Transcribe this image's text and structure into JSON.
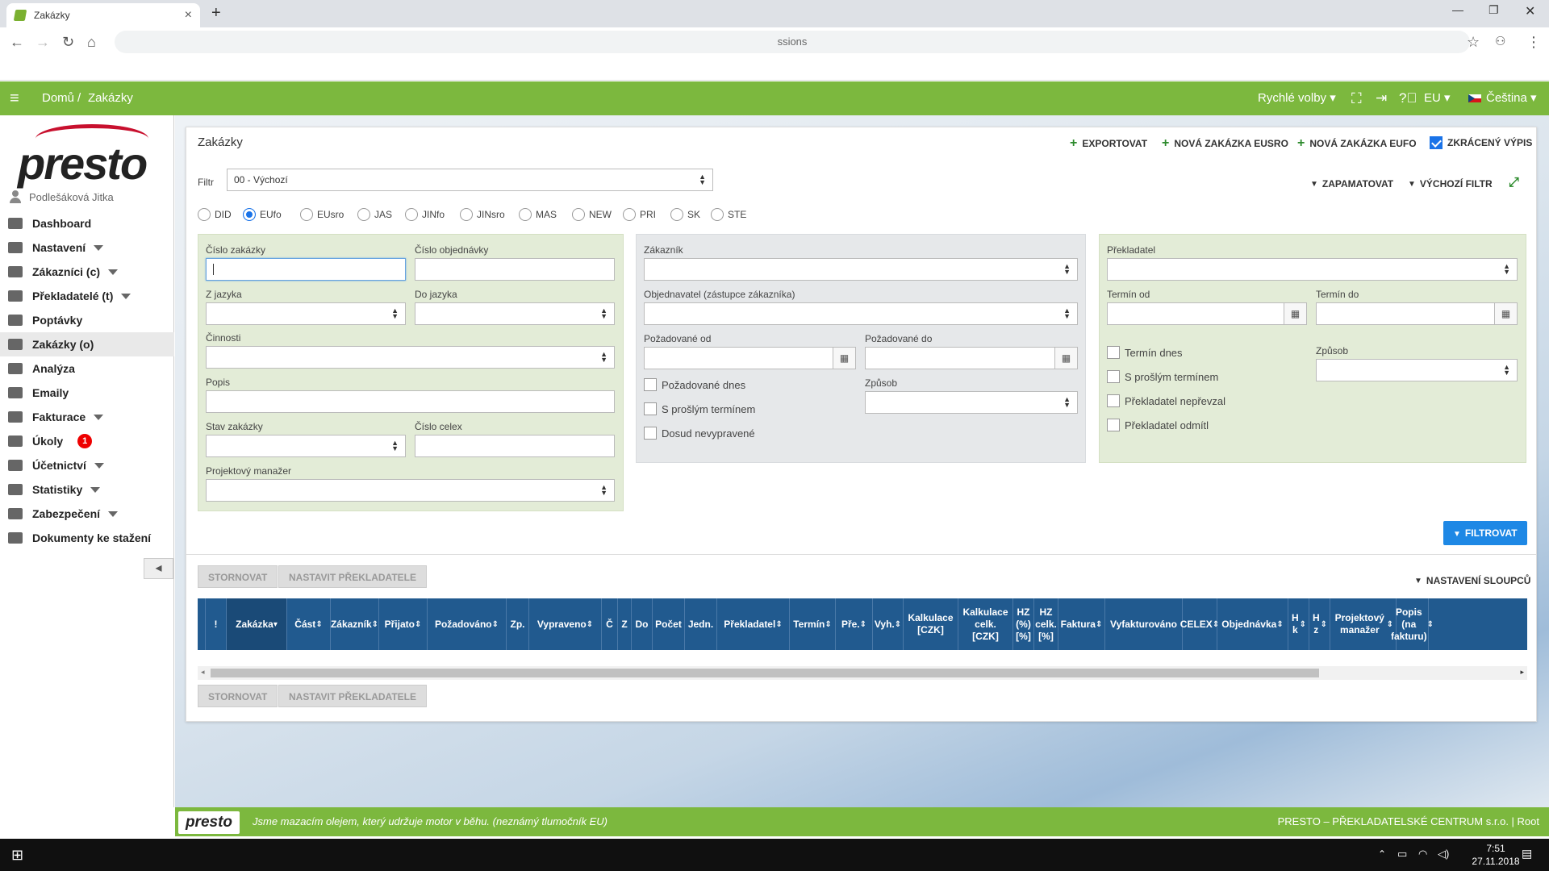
{
  "browser": {
    "tab_title": "Zakázky",
    "address": "ssions"
  },
  "topbar": {
    "home": "Domů",
    "sep": "/",
    "current": "Zakázky",
    "quick": "Rychlé volby",
    "lang_code": "EU",
    "language": "Čeština"
  },
  "user": {
    "name": "Podlešáková Jitka"
  },
  "logo": "presto",
  "menu": [
    {
      "label": "Dashboard",
      "icon": "dashboard-icon",
      "caret": false
    },
    {
      "label": "Nastavení",
      "icon": "cogs-icon",
      "caret": true
    },
    {
      "label": "Zákazníci (c)",
      "icon": "users-icon",
      "caret": true
    },
    {
      "label": "Překladatelé (t)",
      "icon": "globe-icon",
      "caret": true
    },
    {
      "label": "Poptávky",
      "icon": "copy-icon",
      "caret": false
    },
    {
      "label": "Zakázky (o)",
      "icon": "book-icon",
      "caret": false,
      "active": true
    },
    {
      "label": "Analýza",
      "icon": "book-icon",
      "caret": false
    },
    {
      "label": "Emaily",
      "icon": "envelope-icon",
      "caret": false
    },
    {
      "label": "Fakturace",
      "icon": "book-icon",
      "caret": true
    },
    {
      "label": "Úkoly",
      "icon": "tasks-icon",
      "caret": false,
      "badge": "1"
    },
    {
      "label": "Účetnictví",
      "icon": "money-icon",
      "caret": true
    },
    {
      "label": "Statistiky",
      "icon": "chart-icon",
      "caret": true
    },
    {
      "label": "Zabezpečení",
      "icon": "shield-icon",
      "caret": true
    },
    {
      "label": "Dokumenty ke stažení",
      "icon": "cloud-download-icon",
      "caret": false
    }
  ],
  "panel": {
    "title": "Zakázky",
    "export": "EXPORTOVAT",
    "new_eusro": "NOVÁ ZAKÁZKA EUSRO",
    "new_eufo": "NOVÁ ZAKÁZKA EUFO",
    "short": "ZKRÁCENÝ VÝPIS"
  },
  "filter": {
    "label": "Filtr",
    "value": "00 - Výchozí",
    "remember": "ZAPAMATOVAT",
    "default": "VÝCHOZÍ FILTR"
  },
  "radios": [
    "DID",
    "EUfo",
    "EUsro",
    "JAS",
    "JINfo",
    "JINsro",
    "MAS",
    "NEW",
    "PRI",
    "SK",
    "STE"
  ],
  "radio_selected": "EUfo",
  "box1": {
    "cislo_zakazky": "Číslo zakázky",
    "cislo_objednavky": "Číslo objednávky",
    "z_jazyka": "Z jazyka",
    "do_jazyka": "Do jazyka",
    "cinnosti": "Činnosti",
    "popis": "Popis",
    "stav": "Stav zakázky",
    "celex": "Číslo celex",
    "pm": "Projektový manažer"
  },
  "box2": {
    "zakaznik": "Zákazník",
    "objednavatel": "Objednavatel (zástupce zákazníka)",
    "pozad_od": "Požadované od",
    "pozad_do": "Požadované do",
    "dnes": "Požadované dnes",
    "proslym": "S prošlým termínem",
    "nevypravene": "Dosud nevypravené",
    "zpusob": "Způsob"
  },
  "box3": {
    "prekladatel": "Překladatel",
    "termin_od": "Termín od",
    "termin_do": "Termín do",
    "termin_dnes": "Termín dnes",
    "proslym": "S prošlým termínem",
    "nepr": "Překladatel nepřevzal",
    "odm": "Překladatel odmítl",
    "zpusob": "Způsob"
  },
  "buttons": {
    "filter": "FILTROVAT",
    "cancel": "STORNOVAT",
    "set_translator": "NASTAVIT PŘEKLADATELE",
    "columns": "NASTAVENÍ SLOUPCŮ"
  },
  "table_headers": [
    "",
    "!",
    "Zakázka",
    "Část",
    "Zákazník",
    "Přijato",
    "Požadováno",
    "Zp.",
    "Vypraveno",
    "Č",
    "Z",
    "Do",
    "Počet",
    "Jedn.",
    "Překladatel",
    "Termín",
    "Pře.",
    "Vyh.",
    "Kalkulace [CZK]",
    "Kalkulace celk. [CZK]",
    "HZ (%) [%]",
    "HZ celk. [%]",
    "Faktura",
    "Vyfakturováno",
    "CELEX",
    "Objednávka",
    "H k",
    "H z",
    "Projektový manažer",
    "Popis (na fakturu)"
  ],
  "footer": {
    "logo": "presto",
    "slogan": "Jsme mazacím olejem, který udržuje motor v běhu. (neznámý tlumočník EU)",
    "company": "PRESTO – PŘEKLADATELSKÉ CENTRUM s.r.o. | Root"
  },
  "taskbar": {
    "time": "7:51",
    "date": "27.11.2018"
  },
  "colors": {
    "green": "#7cb83e",
    "table_header": "#215a8f",
    "filter_button": "#1e88e5",
    "badge": "#e00000"
  }
}
